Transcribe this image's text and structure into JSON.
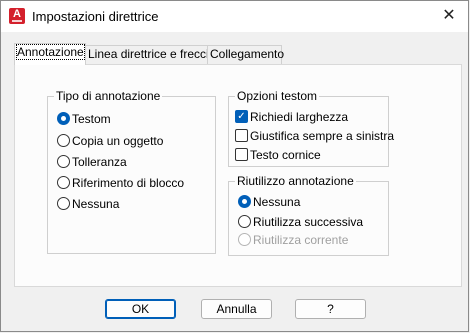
{
  "window": {
    "title": "Impostazioni direttrice",
    "app_icon_letter": "A",
    "close_glyph": "✕"
  },
  "tabs": [
    {
      "label": "Annotazione",
      "active": true
    },
    {
      "label": "Linea direttrice e freccia",
      "active": false
    },
    {
      "label": "Collegamento",
      "active": false
    }
  ],
  "annotation_type": {
    "legend": "Tipo di annotazione",
    "options": [
      {
        "label": "Testom",
        "selected": true
      },
      {
        "label": "Copia un oggetto",
        "selected": false
      },
      {
        "label": "Tolleranza",
        "selected": false
      },
      {
        "label": "Riferimento di blocco",
        "selected": false
      },
      {
        "label": "Nessuna",
        "selected": false
      }
    ]
  },
  "mtext_options": {
    "legend": "Opzioni testom",
    "options": [
      {
        "label": "Richiedi larghezza",
        "checked": true
      },
      {
        "label": "Giustifica sempre a sinistra",
        "checked": false
      },
      {
        "label": "Testo cornice",
        "checked": false
      }
    ]
  },
  "annotation_reuse": {
    "legend": "Riutilizzo annotazione",
    "options": [
      {
        "label": "Nessuna",
        "selected": true,
        "enabled": true
      },
      {
        "label": "Riutilizza successiva",
        "selected": false,
        "enabled": true
      },
      {
        "label": "Riutilizza corrente",
        "selected": false,
        "enabled": false
      }
    ]
  },
  "buttons": {
    "ok": "OK",
    "cancel": "Annulla",
    "help": "?"
  },
  "colors": {
    "accent": "#005fb8",
    "app_icon": "#d4202c"
  }
}
